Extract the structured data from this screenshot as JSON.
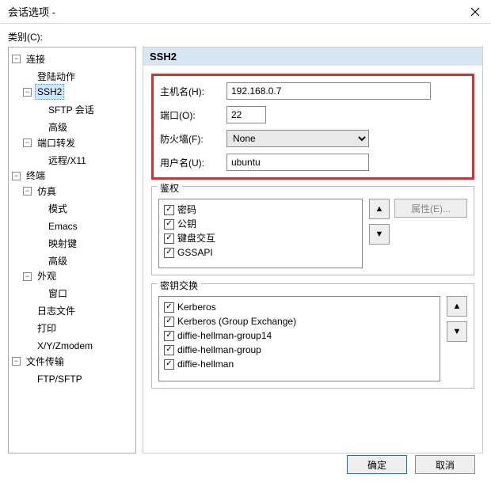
{
  "titlebar": {
    "title": "会话选项 -"
  },
  "labels": {
    "category": "类别(C):"
  },
  "panel": {
    "title": "SSH2"
  },
  "tree": {
    "conn": "连接",
    "login": "登陆动作",
    "ssh2": "SSH2",
    "sftp": "SFTP 会话",
    "advanced": "高级",
    "portfwd": "端口转发",
    "remote": "远程/X11",
    "terminal": "终端",
    "emulation": "仿真",
    "mode": "模式",
    "emacs": "Emacs",
    "mapkeys": "映射键",
    "advanced2": "高级",
    "appearance": "外观",
    "window": "窗口",
    "logfile": "日志文件",
    "print": "打印",
    "zmodem": "X/Y/Zmodem",
    "filetransfer": "文件传输",
    "ftpsftp": "FTP/SFTP"
  },
  "form": {
    "host_label": "主机名(H):",
    "host_value": "192.168.0.7",
    "port_label": "端口(O):",
    "port_value": "22",
    "firewall_label": "防火墙(F):",
    "firewall_value": "None",
    "user_label": "用户名(U):",
    "user_value": "ubuntu"
  },
  "auth": {
    "legend": "鉴权",
    "password": "密码",
    "publickey": "公钥",
    "keyboard": "键盘交互",
    "gssapi": "GSSAPI",
    "attributes": "属性(E)..."
  },
  "kex": {
    "legend": "密钥交换",
    "k1": "Kerberos",
    "k2": "Kerberos (Group Exchange)",
    "k3": "diffie-hellman-group14",
    "k4": "diffie-hellman-group",
    "k5": "diffie-hellman"
  },
  "footer": {
    "ok": "确定",
    "cancel": "取消"
  }
}
